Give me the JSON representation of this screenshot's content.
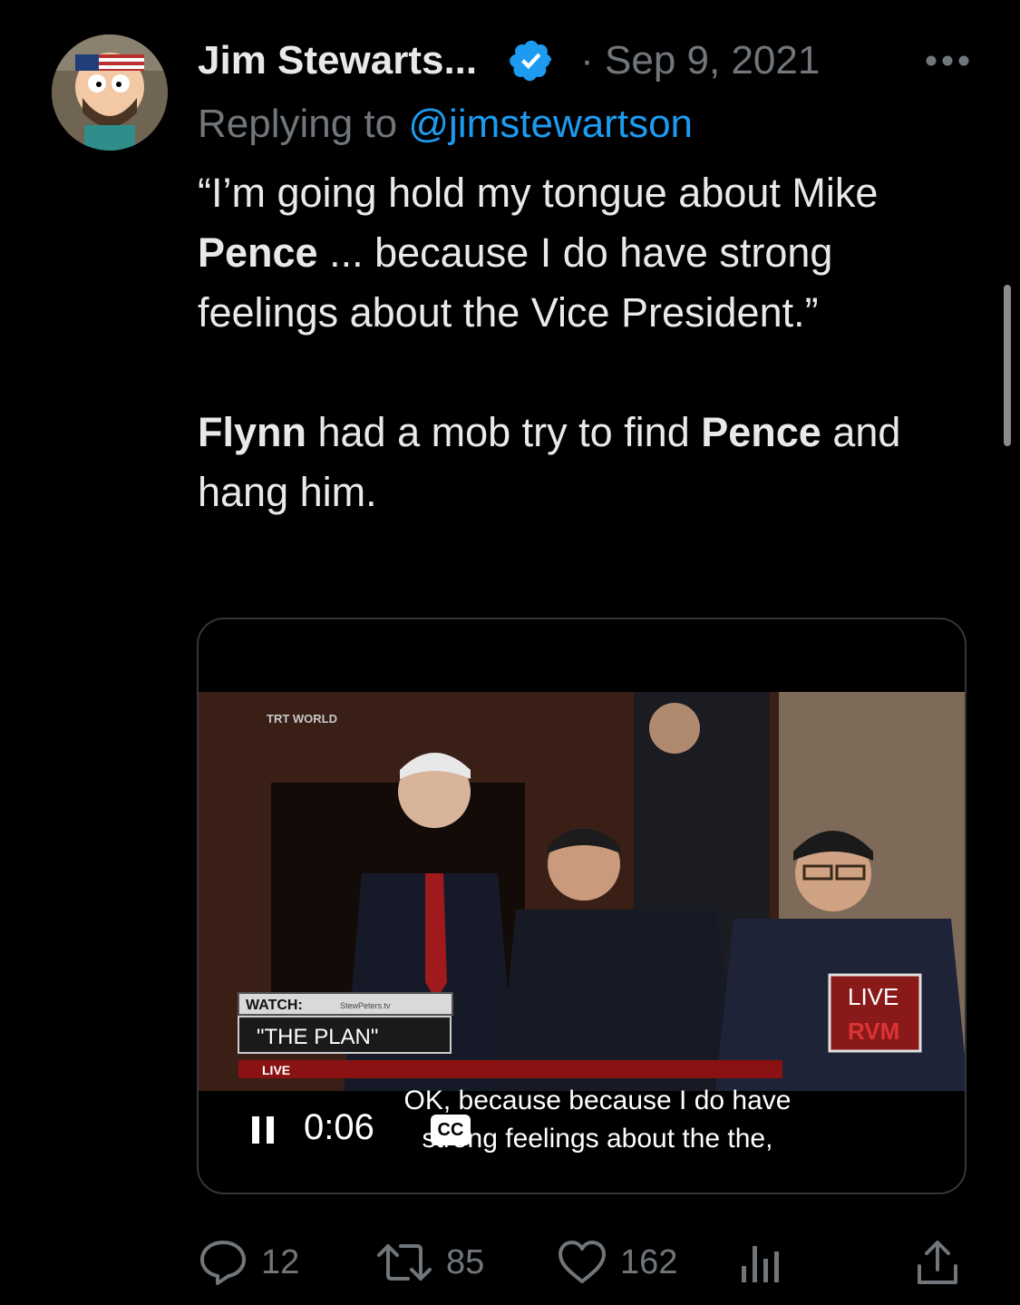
{
  "tweet": {
    "display_name": "Jim Stewarts...",
    "date": "· Sep 9, 2021",
    "reply_prefix": "Replying to",
    "reply_handle": "@jimstewartson",
    "text": {
      "p1_open": "“I’m going hold my tongue about Mike ",
      "p1_bold1": "Pence",
      "p1_rest": " ... because I do have strong feelings about the Vice President.”",
      "p2_bold1": "Flynn",
      "p2_mid": " had a mob try to find ",
      "p2_bold2": "Pence",
      "p2_end": " and hang him."
    }
  },
  "video": {
    "time": "0:06",
    "caption_line1": "OK, because because I do have",
    "caption_line2": "strong feelings about the the,",
    "cc_label": "CC",
    "overlay": {
      "network": "TRT WORLD",
      "watch_label": "WATCH:",
      "watch_source": "StewPeters.tv",
      "show_title": "\"THE PLAN\"",
      "live_label": "LIVE",
      "badge_top": "LIVE",
      "badge_bottom": "RVM"
    }
  },
  "actions": {
    "replies": "12",
    "reposts": "85",
    "likes": "162"
  },
  "colors": {
    "background": "#000000",
    "text": "#e7e9ea",
    "secondary": "#71767b",
    "link": "#1d9bf0",
    "border": "#333639"
  },
  "icons": [
    "avatar",
    "verified-badge-icon",
    "more-icon",
    "pause-icon",
    "cc-icon",
    "reply-icon",
    "repost-icon",
    "like-icon",
    "views-icon",
    "share-icon"
  ]
}
